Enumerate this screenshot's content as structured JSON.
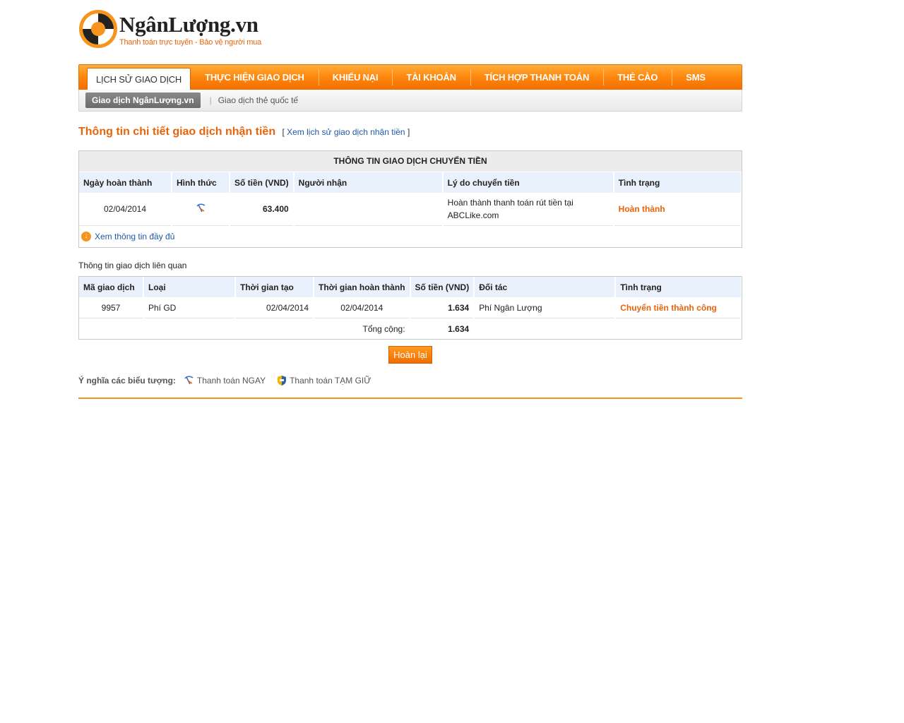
{
  "logo": {
    "name": "NgânLượng.vn",
    "tagline": "Thanh toán trực tuyến - Bảo vệ người mua"
  },
  "main_nav": [
    {
      "label": "LỊCH SỬ GIAO DỊCH",
      "active": true
    },
    {
      "label": "THỰC HIỆN GIAO DỊCH"
    },
    {
      "label": "KHIẾU NẠI"
    },
    {
      "label": "TÀI KHOẢN"
    },
    {
      "label": "TÍCH HỢP THANH TOÁN"
    },
    {
      "label": "THẺ CÀO"
    },
    {
      "label": "SMS"
    }
  ],
  "sub_nav": {
    "active": "Giao dịch NgânLượng.vn",
    "item": "Giao dịch thẻ quốc tế",
    "separator": "|"
  },
  "heading": {
    "title": "Thông tin chi tiết giao dịch nhận tiền",
    "link": "Xem lịch sử giao dịch nhận tiền",
    "bracket_open": "[",
    "bracket_close": "]"
  },
  "transfer_table": {
    "caption": "THÔNG TIN GIAO DỊCH CHUYỂN TIỀN",
    "headers": [
      "Ngày hoàn thành",
      "Hình thức",
      "Số tiền (VND)",
      "Người nhận",
      "Lý do chuyển tiền",
      "Tình trạng"
    ],
    "row": {
      "date": "02/04/2014",
      "method_icon": "instant-payment-icon",
      "amount": "63.400",
      "recipient": "",
      "reason": "Hoàn thành thanh toán rút tiền tại ABCLike.com",
      "status": "Hoàn thành"
    },
    "more_link": "Xem thông tin đầy đủ"
  },
  "related": {
    "label": "Thông tin giao dịch liên quan",
    "headers": [
      "Mã giao dịch",
      "Loại",
      "Thời gian tạo",
      "Thời gian hoàn thành",
      "Số tiền (VND)",
      "Đối tác",
      "Tình trạng"
    ],
    "rows": [
      {
        "id": "9957",
        "type": "Phí GD",
        "created": "02/04/2014",
        "completed": "02/04/2014",
        "amount": "1.634",
        "partner": "Phí Ngân Lượng",
        "status": "Chuyển tiền thành công"
      }
    ],
    "total_label": "Tổng cộng:",
    "total_value": "1.634"
  },
  "back_button": "Hoàn lại",
  "legend": {
    "label": "Ý nghĩa các biểu tượng:",
    "items": [
      {
        "icon": "instant-payment-icon",
        "text": "Thanh toán NGAY"
      },
      {
        "icon": "escrow-shield-icon",
        "text": "Thanh toán TẠM GIỮ"
      }
    ]
  },
  "colors": {
    "accent": "#f7941d",
    "title": "#e8630a",
    "link": "#1f5aa6",
    "table_header": "#e8f1fc"
  }
}
